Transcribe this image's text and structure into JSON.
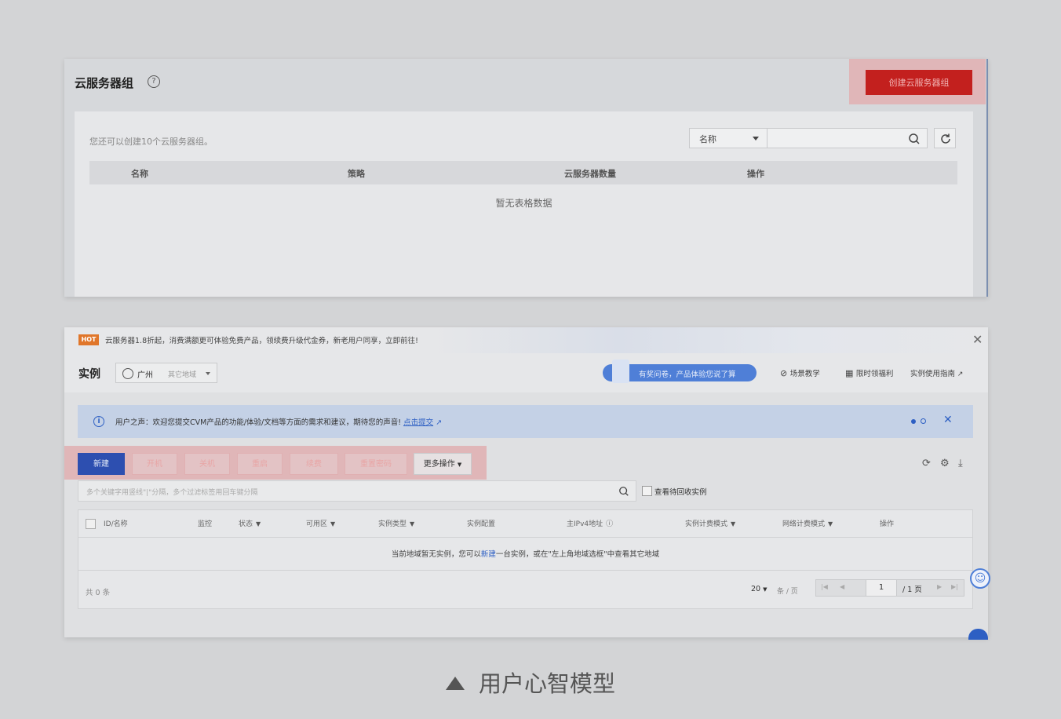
{
  "group_panel": {
    "title": "云服务器组",
    "help_icon": "help-circle-icon",
    "create_button": "创建云服务器组",
    "quota_tip": "您还可以创建10个云服务器组。",
    "filter_select": "名称",
    "search_value": "",
    "columns": [
      "名称",
      "策略",
      "云服务器数量",
      "操作"
    ],
    "empty_text": "暂无表格数据"
  },
  "instance_panel": {
    "hot_badge": "HOT",
    "promo_text": "云服务器1.8折起，消费满额更可体验免费产品，领续费升级代金券，新老用户同享，立即前往!",
    "title": "实例",
    "region": "广州",
    "region_other": "其它地域",
    "feedback_text": "有奖问卷，产品体验您说了算",
    "links": [
      "场景教学",
      "限时领福利",
      "实例使用指南"
    ],
    "notice_prefix": "用户之声：欢迎您提交CVM产品的功能/体验/文档等方面的需求和建议，期待您的声音!",
    "notice_link": "点击提交",
    "buttons": [
      "新建",
      "开机",
      "关机",
      "重启",
      "续费",
      "重置密码",
      "更多操作"
    ],
    "search_placeholder": "多个关键字用竖线\"|\"分隔，多个过滤标签用回车键分隔",
    "recycle_label": "查看待回收实例",
    "columns": [
      "ID/名称",
      "监控",
      "状态",
      "可用区",
      "实例类型",
      "实例配置",
      "主IPv4地址",
      "实例计费模式",
      "网络计费模式",
      "操作"
    ],
    "empty_prefix": "当前地域暂无实例，您可以",
    "empty_link": "新建",
    "empty_suffix": "一台实例，或在\"左上角地域选框\"中查看其它地域",
    "total": "共 0 条",
    "page_size": "20",
    "page_size_unit": "条 / 页",
    "page_current": "1",
    "page_total": "/ 1 页"
  },
  "caption": "用户心智模型",
  "colors": {
    "primary_blue": "#2d4fb0",
    "danger_red": "#c3201e",
    "highlight_pink": "#e0b6b8",
    "hot_orange": "#e0762a"
  }
}
